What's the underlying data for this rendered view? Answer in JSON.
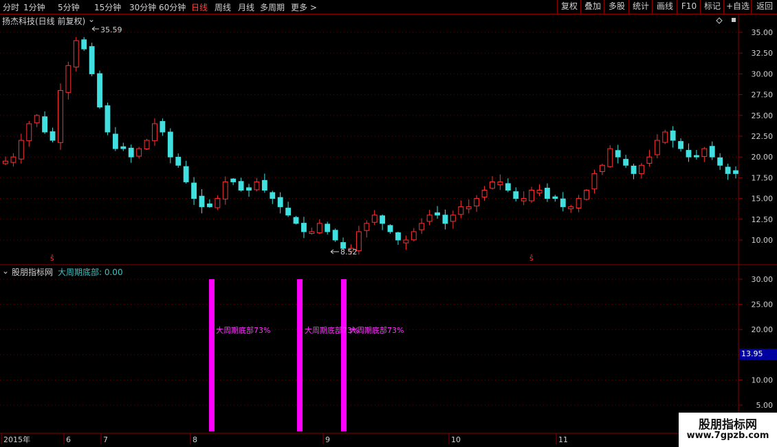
{
  "timeframes": [
    {
      "label": "分时",
      "active": false
    },
    {
      "label": "1分钟",
      "active": false
    },
    {
      "label": "5分钟",
      "active": false
    },
    {
      "label": "15分钟",
      "active": false
    },
    {
      "label": "30分钟",
      "active": false
    },
    {
      "label": "60分钟",
      "active": false
    },
    {
      "label": "日线",
      "active": true
    },
    {
      "label": "周线",
      "active": false
    },
    {
      "label": "月线",
      "active": false
    },
    {
      "label": "多周期",
      "active": false
    },
    {
      "label": "更多 >",
      "active": false
    }
  ],
  "toolbar": [
    "复权",
    "叠加",
    "多股",
    "统计",
    "画线",
    "F10",
    "标记",
    "+自选",
    "返回"
  ],
  "main_panel": {
    "title": "扬杰科技(日线 前复权)",
    "price_axis": [
      "35.00",
      "32.50",
      "30.00",
      "27.50",
      "25.00",
      "22.50",
      "20.00",
      "17.50",
      "15.00",
      "12.50",
      "10.00"
    ],
    "high_label": "35.59",
    "low_label": "8.52",
    "s_marker": "ŝ"
  },
  "indicator_panel": {
    "name": "股朋指标网",
    "series_label": "大周期底部: 0.00",
    "axis": [
      "30.00",
      "25.00",
      "20.00",
      "15.00",
      "10.00",
      "5.00"
    ],
    "cursor_value": "13.95",
    "signal_text": "大周期底部73%"
  },
  "date_axis": [
    "2015年",
    "6",
    "7",
    "8",
    "9",
    "10",
    "11"
  ],
  "watermark": {
    "line1": "股朋指标网",
    "line2": "www.7gpzb.com"
  },
  "colors": {
    "up": "#ff3030",
    "down": "#40e0e0",
    "signal": "#ff00ff",
    "axis": "#8b0000"
  },
  "chart_data": [
    {
      "type": "candlestick",
      "ylim": [
        7.5,
        37.5
      ],
      "high": 35.59,
      "low": 8.52,
      "approx_close_path": [
        19.5,
        20,
        22,
        24,
        25,
        23,
        22,
        28,
        31,
        34,
        33,
        30,
        26,
        23,
        21,
        21,
        20,
        21,
        22,
        24,
        23,
        20,
        19,
        17,
        15,
        14,
        14,
        15,
        17,
        17,
        16,
        16,
        17,
        16,
        15,
        14,
        13,
        12,
        11,
        11,
        12,
        11,
        10,
        9,
        9,
        11,
        12,
        13,
        12,
        11,
        10,
        10,
        11,
        12,
        13,
        13,
        12,
        13,
        14,
        14,
        15,
        16,
        17,
        17,
        16,
        15,
        15,
        16,
        16,
        15,
        15,
        14,
        14,
        15,
        16,
        18,
        19,
        21,
        20,
        19,
        18,
        19,
        20,
        22,
        23,
        22,
        21,
        20,
        20,
        21,
        20,
        19,
        18,
        18
      ]
    },
    {
      "type": "bar",
      "name": "大周期底部",
      "ylim": [
        2.5,
        32.5
      ],
      "values": [
        30,
        30,
        30
      ]
    }
  ]
}
